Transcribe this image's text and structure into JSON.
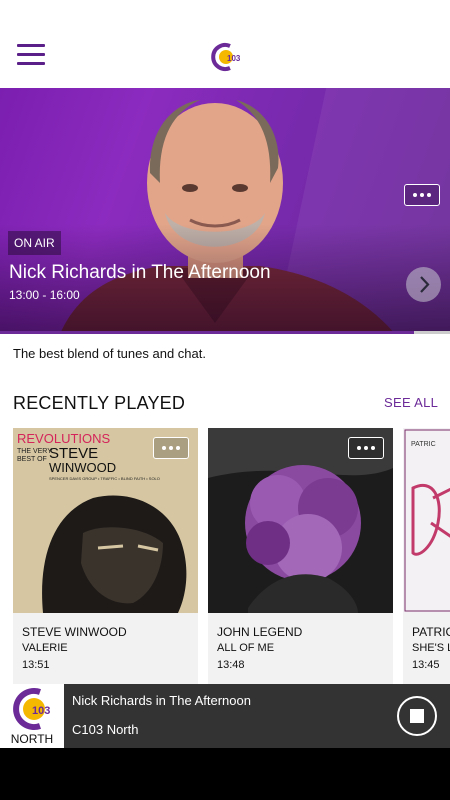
{
  "header": {
    "menu_icon": "hamburger-menu-icon",
    "logo_text": "103",
    "brand_color": "#6b2a98",
    "accent_yellow": "#f5b800"
  },
  "hero": {
    "badge": "ON AIR",
    "show_title": "Nick Richards in The Afternoon",
    "show_time": "13:00 - 16:00",
    "more_icon": "more-options-icon",
    "next_icon": "chevron-right-icon",
    "progress": 0.92
  },
  "tagline": "The best blend of tunes and chat.",
  "recently_played": {
    "title": "RECENTLY PLAYED",
    "see_all": "SEE ALL",
    "items": [
      {
        "artist": "STEVE WINWOOD",
        "song": "VALERIE",
        "time": "13:51",
        "cover_line1": "REVOLUTIONS",
        "cover_line2": "THE VERY",
        "cover_line3": "BEST OF",
        "cover_line4": "STEVE",
        "cover_line5": "WINWOOD",
        "cover_small": "SPENCER DAVIS GROUP • TRAFFIC • BLIND FAITH • SOLO"
      },
      {
        "artist": "JOHN LEGEND",
        "song": "ALL OF ME",
        "time": "13:48"
      },
      {
        "artist": "PATRICK",
        "song": "SHE'S L",
        "time": "13:45",
        "cover_top": "PATRIC"
      }
    ]
  },
  "player": {
    "logo_number": "103",
    "logo_region": "NORTH",
    "now_playing": "Nick Richards in The Afternoon",
    "station": "C103 North",
    "stop_icon": "stop-icon"
  }
}
